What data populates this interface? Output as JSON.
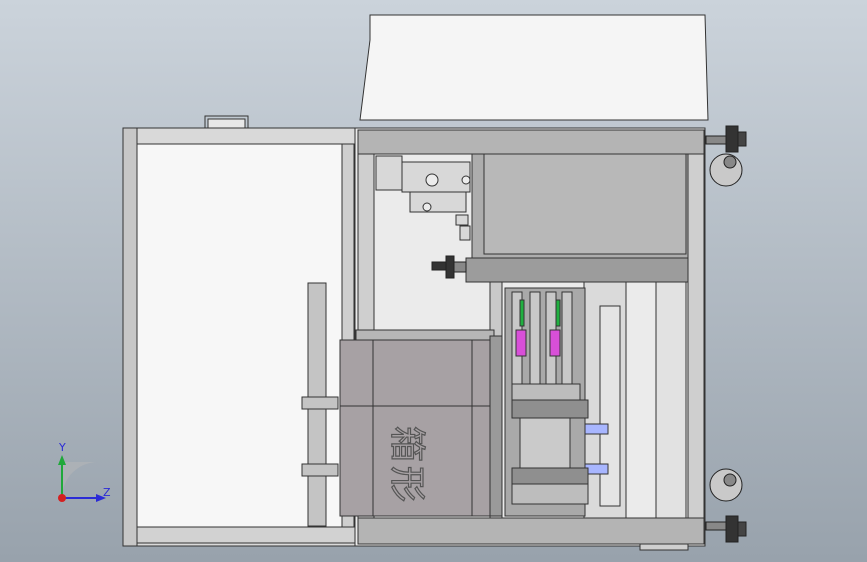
{
  "view": {
    "background_top": "#c8d0d8",
    "background_bottom": "#9aa4ae",
    "outline_color": "#333333",
    "panel_color": "#f4f4f4",
    "frame_color": "#cfcfcf",
    "housing_color": "#a7a1a4"
  },
  "triad": {
    "y_label": "Y",
    "z_label": "Z",
    "y_color": "#1fa83a",
    "z_color": "#2b2bd6",
    "origin_color": "#d42020"
  },
  "housing": {
    "brand_text": "箱",
    "brand_text_2": "形"
  },
  "accent": {
    "green": "#20b040",
    "magenta": "#d050d0",
    "blue_rod": "#a6b4ff"
  }
}
